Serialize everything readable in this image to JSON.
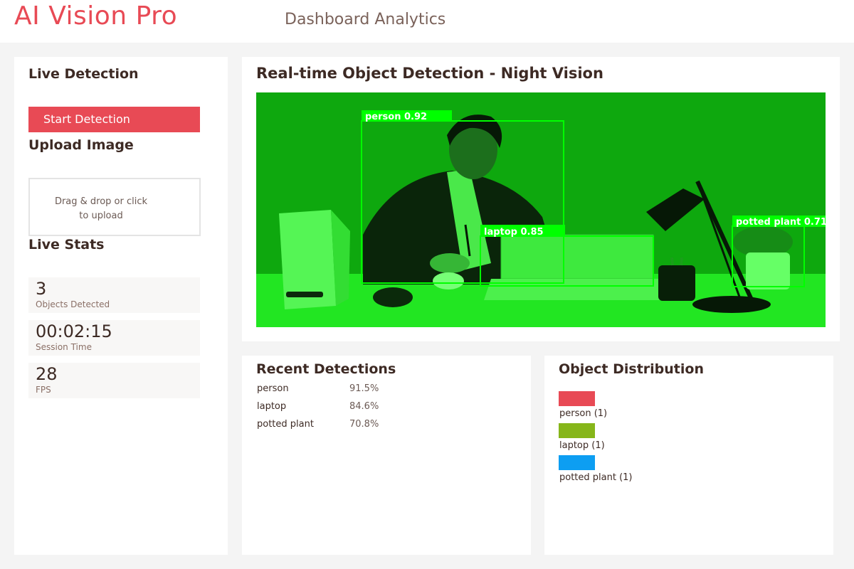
{
  "header": {
    "brand": "AI Vision Pro",
    "subtitle": "Dashboard Analytics"
  },
  "sidebar": {
    "live_detection_title": "Live Detection",
    "start_button": "Start Detection",
    "upload_title": "Upload Image",
    "upload_line1": "Drag & drop or click",
    "upload_line2": "to upload",
    "stats_title": "Live Stats",
    "stats": [
      {
        "value": "3",
        "label": "Objects Detected"
      },
      {
        "value": "00:02:15",
        "label": "Session Time"
      },
      {
        "value": "28",
        "label": "FPS"
      }
    ]
  },
  "main": {
    "title": "Real-time Object Detection - Night Vision",
    "detections": [
      {
        "label": "person 0.92"
      },
      {
        "label": "laptop 0.85"
      },
      {
        "label": "potted plant 0.71"
      }
    ],
    "tint_color": "#00ff00"
  },
  "recent": {
    "title": "Recent Detections",
    "rows": [
      {
        "name": "person",
        "confidence": "91.5%"
      },
      {
        "name": "laptop",
        "confidence": "84.6%"
      },
      {
        "name": "potted plant",
        "confidence": "70.8%"
      }
    ]
  },
  "distribution": {
    "title": "Object Distribution",
    "items": [
      {
        "label": "person (1)",
        "color": "#e84a55"
      },
      {
        "label": "laptop (1)",
        "color": "#86b61a"
      },
      {
        "label": "potted plant (1)",
        "color": "#0d9ef2"
      }
    ]
  },
  "colors": {
    "accent": "#e84a55",
    "detection_box": "#00ff00"
  }
}
